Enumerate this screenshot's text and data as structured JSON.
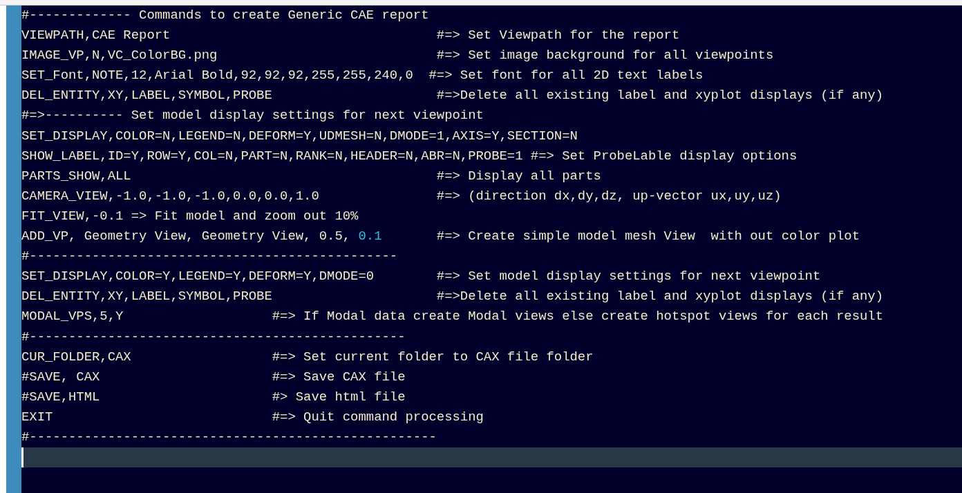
{
  "editor": {
    "lines": [
      {
        "text": "#------------- Commands to create Generic CAE report"
      },
      {
        "text": "VIEWPATH,CAE Report                                  #=> Set Viewpath for the report"
      },
      {
        "text": "IMAGE_VP,N,VC_ColorBG.png                            #=> Set image background for all viewpoints"
      },
      {
        "text": "SET_Font,NOTE,12,Arial Bold,92,92,92,255,255,240,0  #=> Set font for all 2D text labels"
      },
      {
        "text": "DEL_ENTITY,XY,LABEL,SYMBOL,PROBE                     #=>Delete all existing label and xyplot displays (if any)"
      },
      {
        "text": "#=>---------- Set model display settings for next viewpoint"
      },
      {
        "text": "SET_DISPLAY,COLOR=N,LEGEND=N,DEFORM=Y,UDMESH=N,DMODE=1,AXIS=Y,SECTION=N"
      },
      {
        "text": "SHOW_LABEL,ID=Y,ROW=Y,COL=N,PART=N,RANK=N,HEADER=N,ABR=N,PROBE=1 #=> Set ProbeLable display options"
      },
      {
        "text": "PARTS_SHOW,ALL                                       #=> Display all parts"
      },
      {
        "text": "CAMERA_VIEW,-1.0,-1.0,-1.0,0.0,0.0,1.0               #=> (direction dx,dy,dz, up-vector ux,uy,uz)"
      },
      {
        "text": "FIT_VIEW,-0.1 => Fit model and zoom out 10%"
      },
      {
        "parts": [
          {
            "text": "ADD_VP, Geometry View, Geometry View, 0.5, ",
            "kind": "plain"
          },
          {
            "text": "0.1",
            "kind": "number"
          },
          {
            "text": "       #=> Create simple model mesh View  with out color plot",
            "kind": "plain"
          }
        ]
      },
      {
        "text": "#-----------------------------------------------"
      },
      {
        "text": "SET_DISPLAY,COLOR=Y,LEGEND=Y,DEFORM=Y,DMODE=0        #=> Set model display settings for next viewpoint"
      },
      {
        "text": "DEL_ENTITY,XY,LABEL,SYMBOL,PROBE                     #=>Delete all existing label and xyplot displays (if any)"
      },
      {
        "text": "MODAL_VPS,5,Y                   #=> If Modal data create Modal views else create hotspot views for each result"
      },
      {
        "text": "#------------------------------------------------"
      },
      {
        "text": "CUR_FOLDER,CAX                  #=> Set current folder to CAX file folder"
      },
      {
        "text": "#SAVE, CAX                      #=> Save CAX file"
      },
      {
        "text": "#SAVE,HTML                      #> Save html file"
      },
      {
        "text": "EXIT                            #=> Quit command processing"
      },
      {
        "text": "#----------------------------------------------------"
      }
    ]
  }
}
